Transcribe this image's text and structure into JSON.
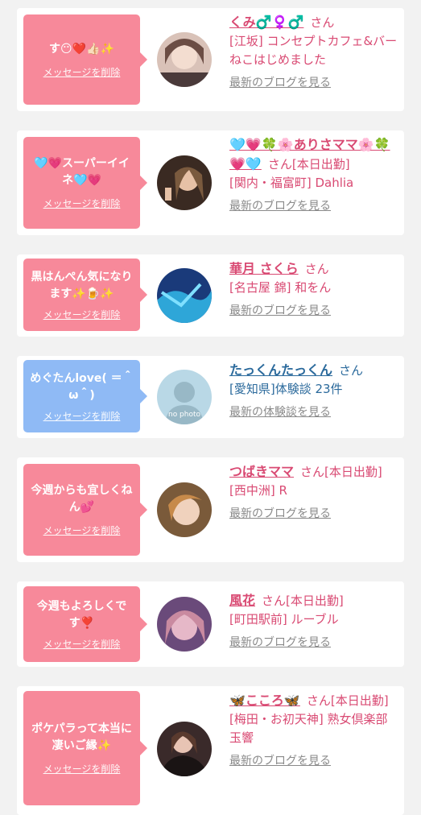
{
  "messages": [
    {
      "message": "す😶❤️👍🏻✨",
      "delete_label": "メッセージを削除",
      "name": "くみ♂️♀️♂️",
      "san": "さん",
      "status": "",
      "shop": "[江坂] コンセプトカフェ&バー　ねこはじめました",
      "link": "最新のブログを見る",
      "bubble_color": "#f7899a"
    },
    {
      "message": "🩵💗スーパーイイネ🩵💗",
      "delete_label": "メッセージを削除",
      "name": "🩵💗🍀🌸ありさママ🌸🍀💗🩵",
      "san": "さん",
      "status": "[本日出勤]",
      "shop": "[関内・福富町] Dahlia",
      "link": "最新のブログを見る",
      "bubble_color": "#f7899a"
    },
    {
      "message": "黒はんぺん気になります✨🍺✨",
      "delete_label": "メッセージを削除",
      "name": "華月 さくら",
      "san": "さん",
      "status": "",
      "shop": "[名古屋 錦] 和をん",
      "link": "最新のブログを見る",
      "bubble_color": "#f7899a"
    },
    {
      "message": "めぐたんlove( ＝＾ω＾)",
      "delete_label": "メッセージを削除",
      "name": "たっくんたっくん",
      "san": "さん",
      "status": "",
      "shop": "[愛知県]体験談 23件",
      "link": "最新の体験談を見る",
      "bubble_color": "#8fbaf5",
      "avatar_text": "no photo"
    },
    {
      "message": "今週からも宜しくねん💕",
      "delete_label": "メッセージを削除",
      "name": "つばきママ",
      "san": "さん",
      "status": "[本日出勤]",
      "shop": "[西中洲] R",
      "link": "最新のブログを見る",
      "bubble_color": "#f7899a"
    },
    {
      "message": "今週もよろしくです❣️",
      "delete_label": "メッセージを削除",
      "name": "風花",
      "san": "さん",
      "status": "[本日出勤]",
      "shop": "[町田駅前] ルーブル",
      "link": "最新のブログを見る",
      "bubble_color": "#f7899a"
    },
    {
      "message": "ポケパラって本当に凄いご縁✨",
      "delete_label": "メッセージを削除",
      "name": "🦋こころ🦋",
      "san": "さん",
      "status": "[本日出勤]",
      "shop": "[梅田・お初天神] 熟女倶楽部 玉響",
      "link": "最新のブログを見る",
      "bubble_color": "#f7899a"
    }
  ]
}
